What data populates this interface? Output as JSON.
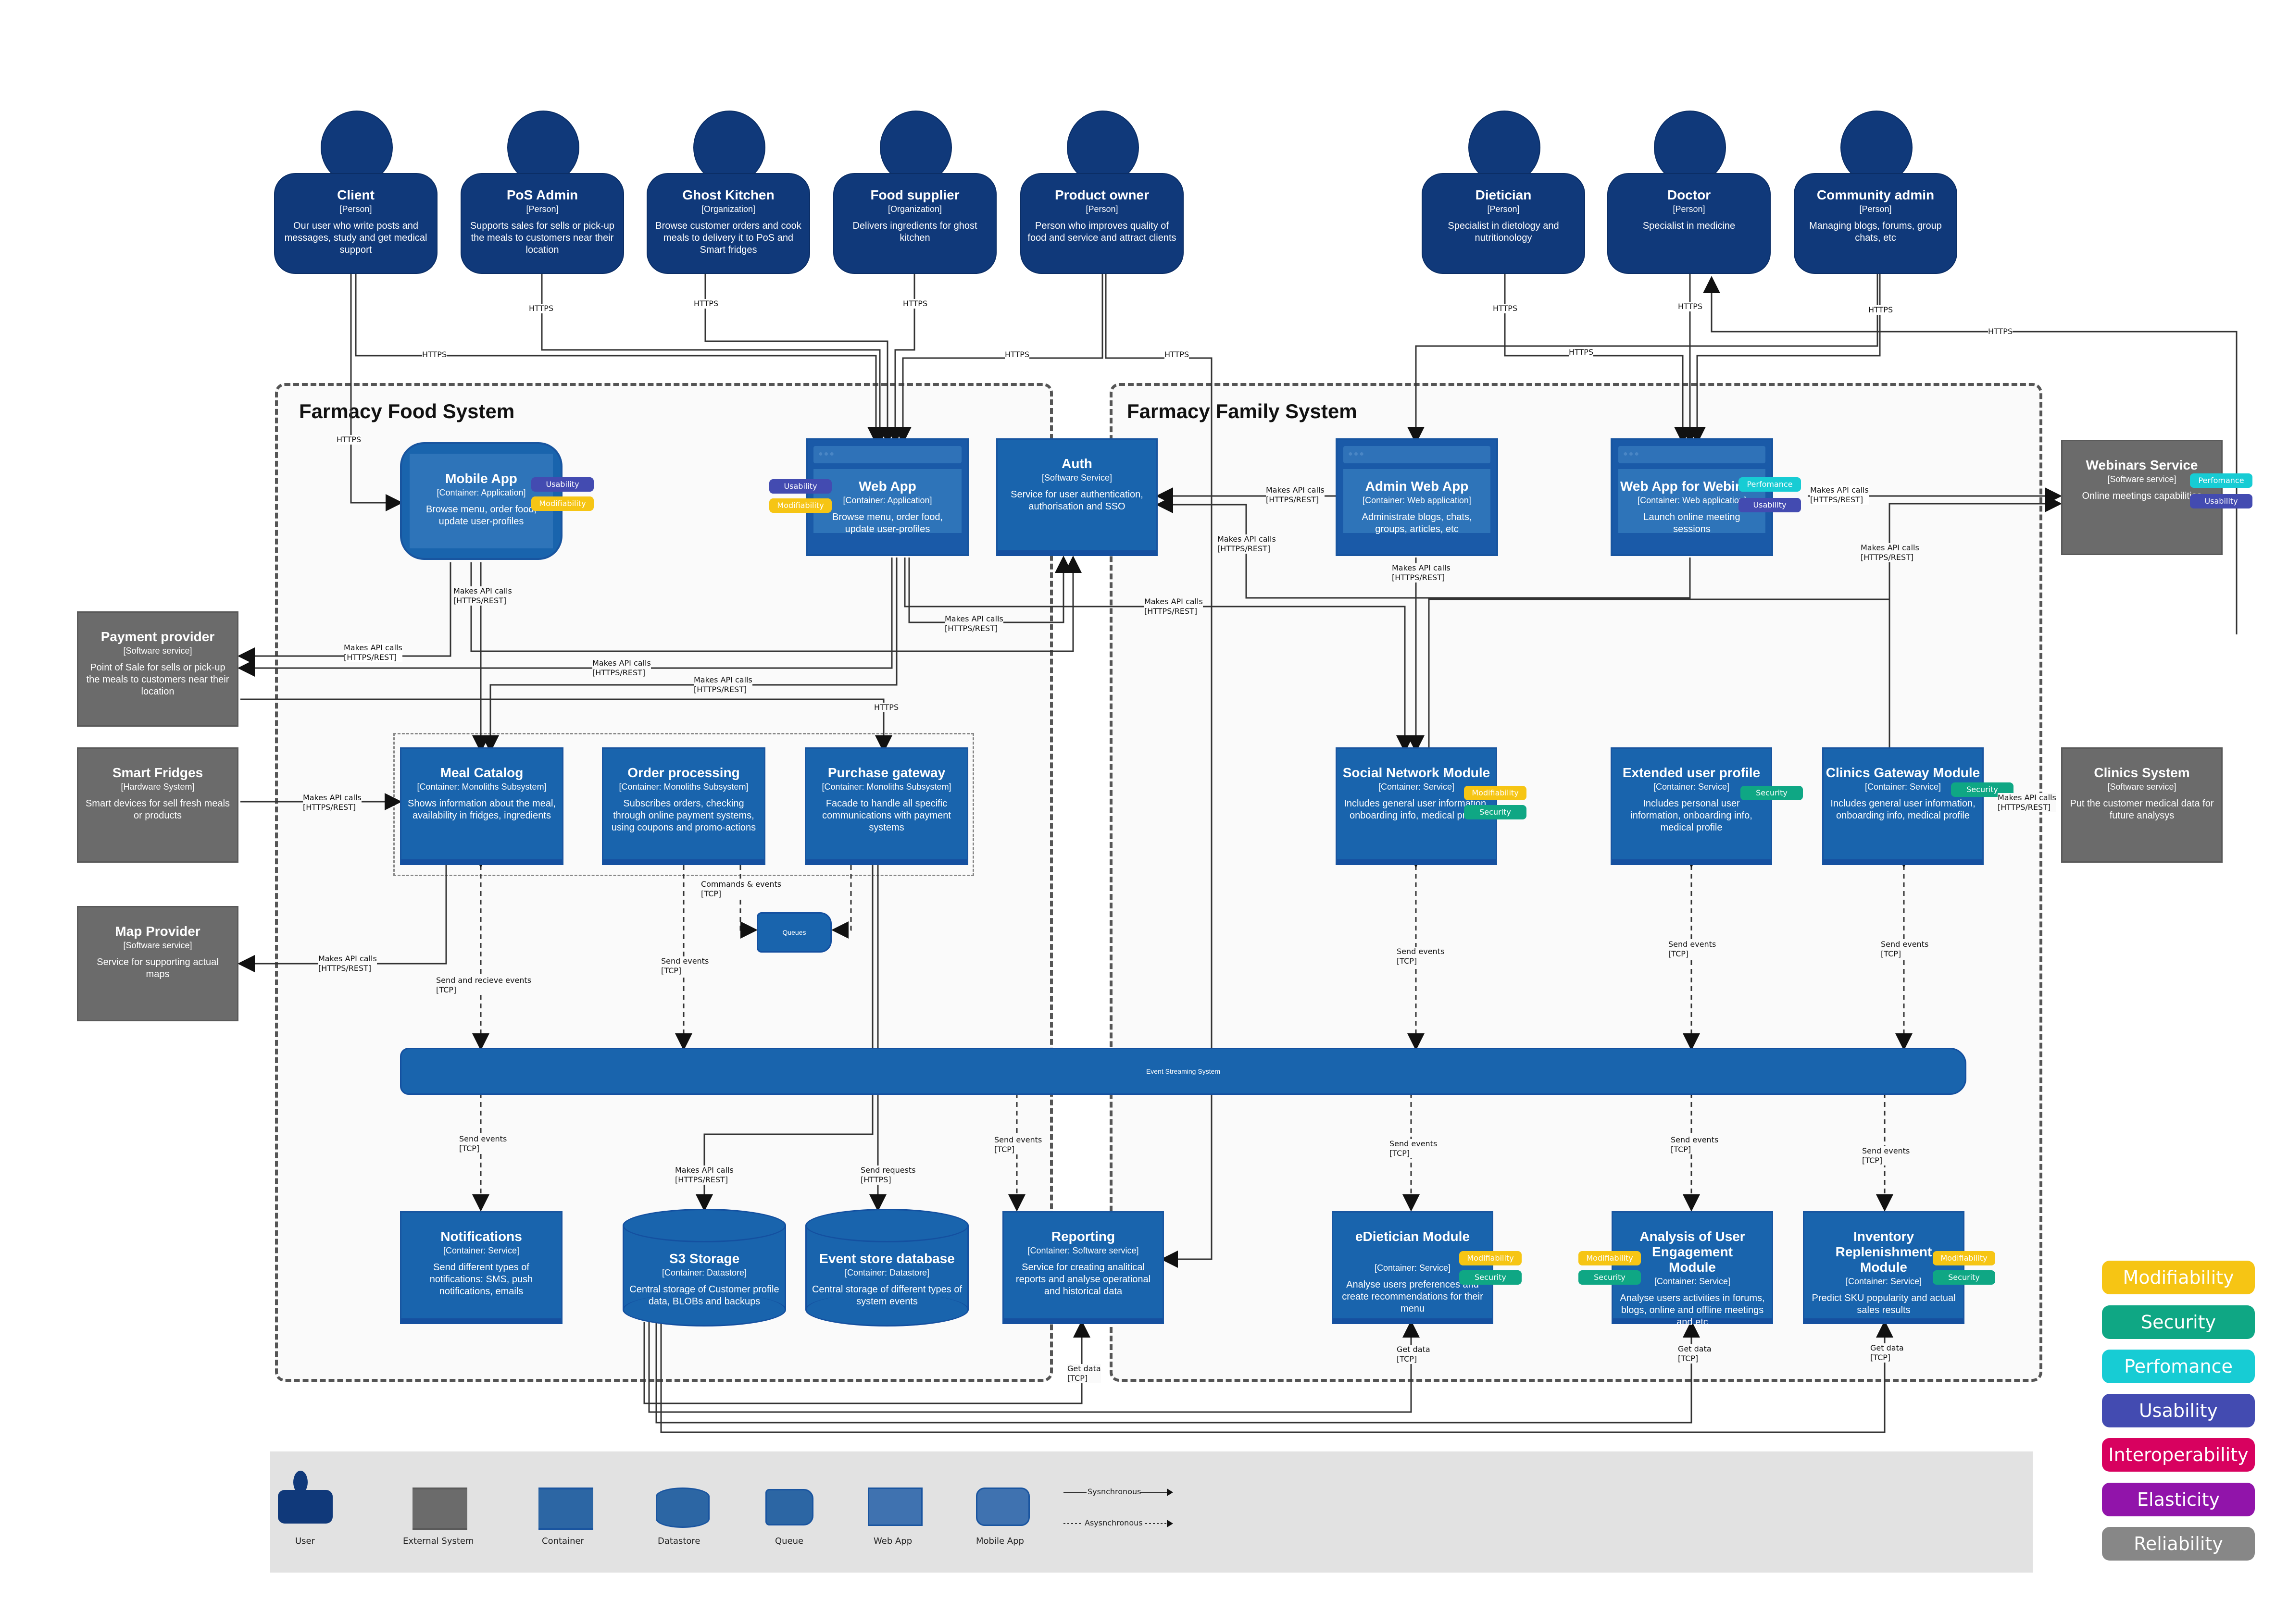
{
  "boundaries": {
    "food": {
      "title": "Farmacy Food System"
    },
    "family": {
      "title": "Farmacy Family System"
    }
  },
  "people": [
    {
      "id": "client",
      "name": "Client",
      "type": "[Person]",
      "desc": "Our user who write posts and messages, study and get medical support"
    },
    {
      "id": "pos-admin",
      "name": "PoS Admin",
      "type": "[Person]",
      "desc": "Supports sales for sells or pick-up the meals to customers near their location"
    },
    {
      "id": "ghost-kitchen",
      "name": "Ghost Kitchen",
      "type": "[Organization]",
      "desc": "Browse customer orders and cook meals to delivery it to PoS and Smart fridges"
    },
    {
      "id": "food-supplier",
      "name": "Food supplier",
      "type": "[Organization]",
      "desc": "Delivers ingredients for ghost kitchen"
    },
    {
      "id": "product-owner",
      "name": "Product owner",
      "type": "[Person]",
      "desc": "Person who improves quality of food and service and attract clients"
    },
    {
      "id": "dietician",
      "name": "Dietician",
      "type": "[Person]",
      "desc": "Specialist in dietology and nutritionology"
    },
    {
      "id": "doctor",
      "name": "Doctor",
      "type": "[Person]",
      "desc": "Specialist in medicine"
    },
    {
      "id": "community-admin",
      "name": "Community admin",
      "type": "[Person]",
      "desc": "Managing blogs, forums, group chats, etc"
    }
  ],
  "external_systems": [
    {
      "id": "payment-provider",
      "name": "Payment provider",
      "type": "[Software service]",
      "desc": "Point of Sale for sells or pick-up the meals to customers near their location"
    },
    {
      "id": "smart-fridges",
      "name": "Smart Fridges",
      "type": "[Hardware System]",
      "desc": "Smart devices for sell fresh meals or products"
    },
    {
      "id": "map-provider",
      "name": "Map Provider",
      "type": "[Software service]",
      "desc": "Service for supporting actual maps"
    },
    {
      "id": "webinars-service",
      "name": "Webinars Service",
      "type": "[Software service]",
      "desc": "Online meetings capabilities",
      "tags": [
        "Perfomance",
        "Usability"
      ]
    },
    {
      "id": "clinics-system",
      "name": "Clinics System",
      "type": "[Software service]",
      "desc": "Put the customer medical data for future analysys"
    }
  ],
  "containers": [
    {
      "id": "mobile-app",
      "name": "Mobile App",
      "type": "[Container: Application]",
      "desc": "Browse menu, order food, update user-profiles",
      "tags": [
        "Usability",
        "Modifiability"
      ]
    },
    {
      "id": "web-app",
      "name": "Web App",
      "type": "[Container: Application]",
      "desc": "Browse menu, order food, update user-profiles",
      "tags": [
        "Usability",
        "Modifiability"
      ]
    },
    {
      "id": "auth",
      "name": "Auth",
      "type": "[Software Service]",
      "desc": "Service for user authentication, authorisation and SSO"
    },
    {
      "id": "admin-web-app",
      "name": "Admin Web App",
      "type": "[Container: Web application]",
      "desc": "Administrate blogs, chats, groups, articles, etc"
    },
    {
      "id": "webinars-web-app",
      "name": "Web App for Webinars",
      "type": "[Container: Web application]",
      "desc": "Launch online meeting sessions",
      "tags": [
        "Perfomance",
        "Usability"
      ]
    },
    {
      "id": "meal-catalog",
      "name": "Meal Catalog",
      "type": "[Container: Monoliths Subsystem]",
      "desc": "Shows information about the meal, availability in fridges, ingredients"
    },
    {
      "id": "order-processing",
      "name": "Order processing",
      "type": "[Container: Monoliths Subsystem]",
      "desc": "Subscribes orders, checking through online payment systems, using coupons and promo-actions"
    },
    {
      "id": "purchase-gateway",
      "name": "Purchase gateway",
      "type": "[Container: Monoliths Subsystem]",
      "desc": "Facade to handle all specific communications with payment systems"
    },
    {
      "id": "social-network",
      "name": "Social Network Module",
      "type": "[Container: Service]",
      "desc": "Includes general user information, onboarding info, medical profile",
      "tags": [
        "Modifiability",
        "Security"
      ]
    },
    {
      "id": "extended-profile",
      "name": "Extended user profile",
      "type": "[Container: Service]",
      "desc": "Includes personal user information, onboarding info, medical profile",
      "tags": [
        "Security"
      ]
    },
    {
      "id": "clinics-gateway",
      "name": "Clinics Gateway Module",
      "type": "[Container: Service]",
      "desc": "Includes general user information, onboarding info, medical profile",
      "tags": [
        "Security"
      ]
    },
    {
      "id": "notifications",
      "name": "Notifications",
      "type": "[Container: Service]",
      "desc": "Send different types of notifications: SMS, push notifications, emails"
    },
    {
      "id": "reporting",
      "name": "Reporting",
      "type": "[Container: Software service]",
      "desc": "Service for creating analitical reports and analyse operational and historical data"
    },
    {
      "id": "edietician",
      "name": "eDietician Module",
      "type": "[Container: Service]",
      "desc": "Analyse users preferences and create recommendations for their menu",
      "tags": [
        "Modifiability",
        "Security"
      ]
    },
    {
      "id": "engagement",
      "name": "Analysis of User Engagement Module",
      "type": "[Container: Service]",
      "desc": "Analyse users activities in forums, blogs, online and offline meetings and etc",
      "tags": [
        "Modifiability",
        "Security"
      ]
    },
    {
      "id": "inventory",
      "name": "Inventory Replenishment Module",
      "type": "[Container: Service]",
      "desc": "Predict SKU popularity and actual sales results",
      "tags": [
        "Modifiability",
        "Security"
      ]
    }
  ],
  "datastores": [
    {
      "id": "s3",
      "name": "S3 Storage",
      "type": "[Container: Datastore]",
      "desc": "Central storage of Customer profile data, BLOBs and backups"
    },
    {
      "id": "event-store",
      "name": "Event store database",
      "type": "[Container: Datastore]",
      "desc": "Central storage of different types of system events"
    }
  ],
  "queues": {
    "queues": "Queues",
    "event_bus": "Event Streaming System"
  },
  "edge_labels": {
    "https": "HTTPS",
    "api": "Makes API calls",
    "api_proto": "[HTTPS/REST]",
    "send_events": "Send events",
    "send_recv_events": "Send and recieve events",
    "commands_events": "Commands & events",
    "tcp": "[TCP]",
    "send_requests": "Send requests",
    "https_b": "[HTTPS]",
    "get_data": "Get data"
  },
  "legend": {
    "items": [
      "User",
      "External  System",
      "Container",
      "Datastore",
      "Queue",
      "Web App",
      "Mobile App"
    ],
    "sync": "Sysnchronous",
    "async": "Asysnchronous"
  },
  "quality_attributes": [
    {
      "name": "Modifiability",
      "color": "#f6c514"
    },
    {
      "name": "Security",
      "color": "#0fa784"
    },
    {
      "name": "Perfomance",
      "color": "#17ccd4"
    },
    {
      "name": "Usability",
      "color": "#434bb1"
    },
    {
      "name": "Interoperability",
      "color": "#d8015f"
    },
    {
      "name": "Elasticity",
      "color": "#9114aa"
    },
    {
      "name": "Reliability",
      "color": "#878787"
    }
  ],
  "colors": {
    "person": "#10397a",
    "container": "#1964ad",
    "external": "#6b6b6b",
    "legend_bg": "#e2e2e2"
  }
}
